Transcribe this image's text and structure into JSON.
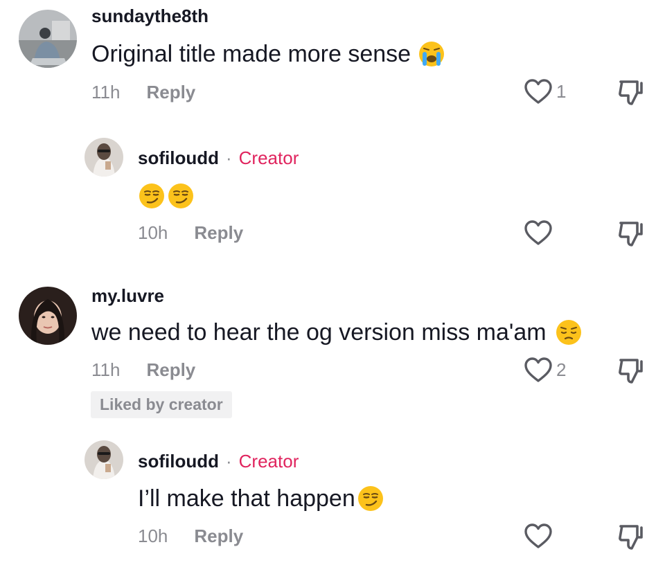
{
  "comments": [
    {
      "username": "sundaythe8th",
      "text": "Original title made more sense",
      "emoji": "loudly-crying-face",
      "time": "11h",
      "reply_label": "Reply",
      "likes": "1"
    },
    {
      "username": "sofiloudd",
      "separator": "·",
      "badge": "Creator",
      "text": "",
      "emoji": "smirking-face x2",
      "time": "10h",
      "reply_label": "Reply",
      "likes": ""
    },
    {
      "username": "my.luvre",
      "text": "we need to hear the og version miss ma'am",
      "emoji": "pensive-face",
      "time": "11h",
      "reply_label": "Reply",
      "likes": "2",
      "liked_by_creator": "Liked by creator"
    },
    {
      "username": "sofiloudd",
      "separator": "·",
      "badge": "Creator",
      "text": "I’ll make that happen",
      "emoji": "smirking-face",
      "time": "10h",
      "reply_label": "Reply",
      "likes": ""
    }
  ],
  "colors": {
    "creator_accent": "#e0245e",
    "meta_gray": "#8a8b91",
    "text_dark": "#161823",
    "badge_bg": "#f1f1f2"
  },
  "icons": [
    "heart-outline-icon",
    "thumbs-down-icon"
  ]
}
